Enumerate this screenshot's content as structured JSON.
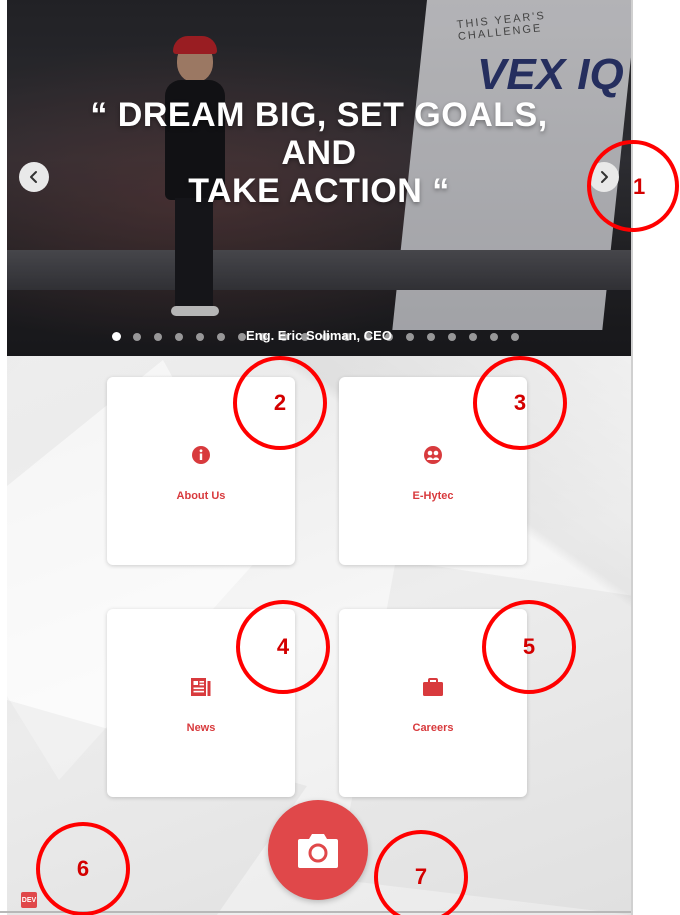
{
  "hero": {
    "quote_lines": [
      "“ DREAM BIG, SET GOALS,",
      "AND",
      "TAKE ACTION “"
    ],
    "caption": "Eng. Eric Soliman, CEO",
    "wall_text": "THIS YEAR'S CHALLENGE",
    "wall_logo": "VEX IQ",
    "dot_count": 20,
    "active_dot": 0
  },
  "menu": {
    "about": {
      "label": "About Us",
      "icon": "info-circle-icon"
    },
    "ehytec": {
      "label": "E-Hytec",
      "icon": "group-circle-icon"
    },
    "news": {
      "label": "News",
      "icon": "newspaper-icon"
    },
    "careers": {
      "label": "Careers",
      "icon": "briefcase-icon"
    }
  },
  "fab": {
    "icon": "camera-icon"
  },
  "dev_badge": "DEV",
  "annotations": [
    "1",
    "2",
    "3",
    "4",
    "5",
    "6",
    "7"
  ],
  "colors": {
    "accent": "#e0484a",
    "label_red": "#d83a3d",
    "annotation": "#ff0000"
  }
}
